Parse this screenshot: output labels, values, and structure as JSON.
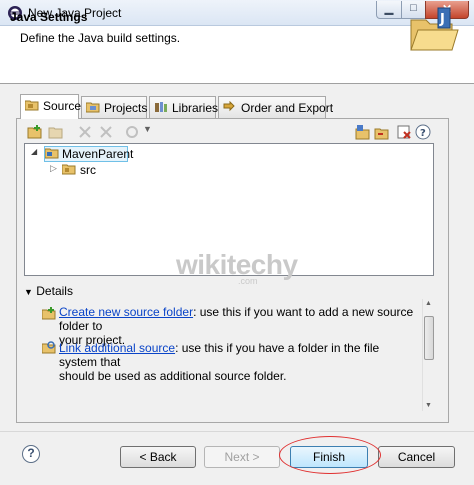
{
  "window": {
    "title": "New Java Project"
  },
  "banner": {
    "title": "Java Settings",
    "description": "Define the Java build settings."
  },
  "tabs": [
    {
      "label": "Source",
      "active": true,
      "icon": "source-folder-icon"
    },
    {
      "label": "Projects",
      "active": false,
      "icon": "projects-folder-icon"
    },
    {
      "label": "Libraries",
      "active": false,
      "icon": "libraries-icon"
    },
    {
      "label": "Order and Export",
      "active": false,
      "icon": "order-export-icon"
    }
  ],
  "tree": {
    "items": [
      {
        "label": "MavenParent",
        "expanded": true
      },
      {
        "label": "src",
        "expanded": false
      }
    ]
  },
  "watermark": {
    "text": "wikitechy",
    "sub": ".com"
  },
  "details": {
    "header": "Details",
    "item1": {
      "link": "Create new source folder",
      "text": ": use this if you want to add a new source folder to",
      "text2": "your project."
    },
    "item2": {
      "link": "Link additional source",
      "text": ": use this if you have a folder in the file system that",
      "text2": "should be used as additional source folder."
    }
  },
  "buttons": {
    "help": "?",
    "back": "< Back",
    "next": "Next >",
    "finish": "Finish",
    "cancel": "Cancel"
  },
  "colors": {
    "link": "#0a44c8",
    "highlight_ring": "#e03030",
    "selection": "#e5f3fb"
  }
}
